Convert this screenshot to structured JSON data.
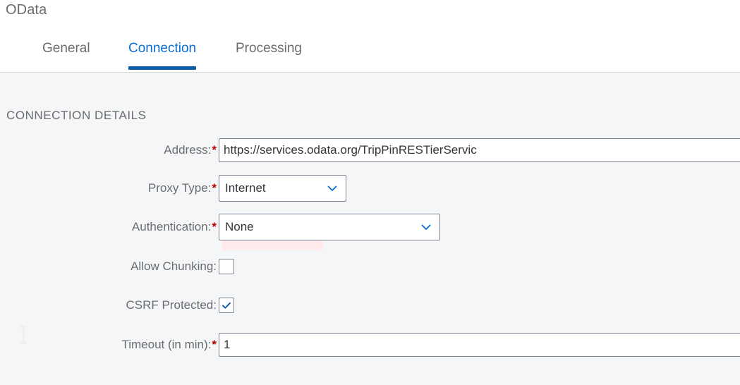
{
  "header": {
    "title": "OData"
  },
  "tabs": [
    {
      "id": "general",
      "label": "General",
      "active": false
    },
    {
      "id": "connection",
      "label": "Connection",
      "active": true
    },
    {
      "id": "processing",
      "label": "Processing",
      "active": false
    }
  ],
  "section": {
    "title": "CONNECTION DETAILS"
  },
  "fields": {
    "address": {
      "label": "Address:",
      "required": true,
      "value": "https://services.odata.org/TripPinRESTierServic",
      "placeholder": ""
    },
    "proxy_type": {
      "label": "Proxy Type:",
      "required": true,
      "value": "Internet"
    },
    "authentication": {
      "label": "Authentication:",
      "required": true,
      "value": "None"
    },
    "allow_chunking": {
      "label": "Allow Chunking:",
      "required": false,
      "checked": false
    },
    "csrf_protected": {
      "label": "CSRF Protected:",
      "required": true,
      "checked": true
    },
    "timeout": {
      "label": "Timeout (in min):",
      "required": true,
      "value": "1",
      "placeholder": ""
    }
  },
  "icons": {
    "chevron_down": "chevron-down-icon",
    "check": "check-icon",
    "text_cursor": "i-beam-cursor"
  },
  "colors": {
    "accent": "#0a6ed1",
    "tab_underline": "#0a5fa8",
    "required_star": "#bb0000",
    "error_highlight": "#ffebeb",
    "label_text": "#6a6d70",
    "value_text": "#32363a",
    "field_border": "#7b8290",
    "page_background": "#f5f6f7",
    "header_background": "#ffffff"
  }
}
